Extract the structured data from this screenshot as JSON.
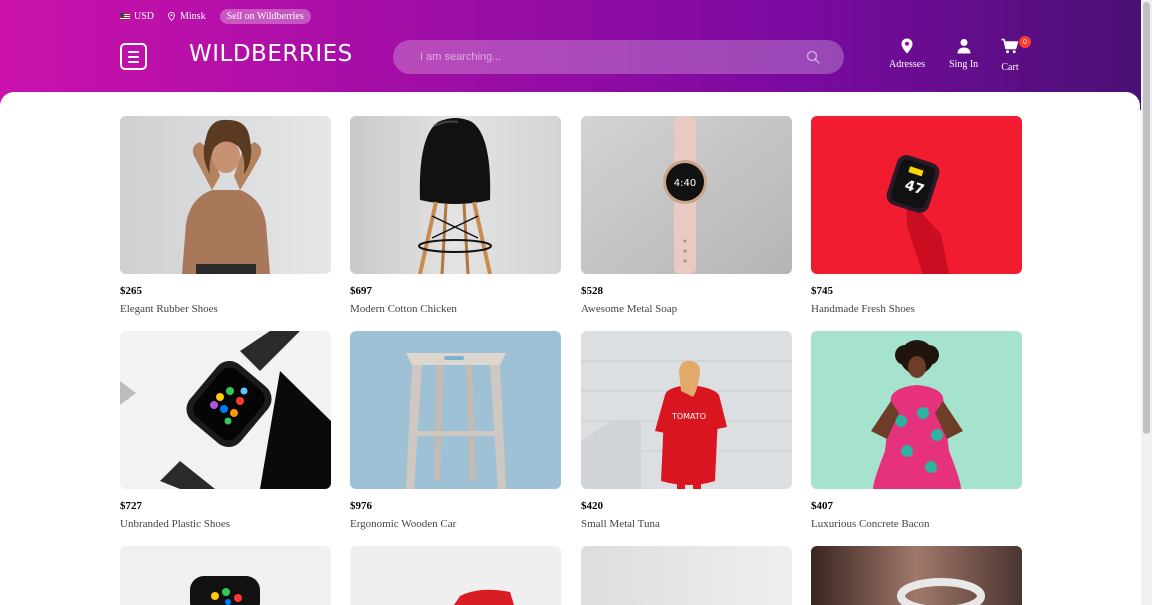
{
  "header": {
    "currency": "USD",
    "city": "Minsk",
    "sell_label": "Sell on Wildberries",
    "logo": "WILDBERRIES",
    "search_placeholder": "I am searching...",
    "addresses_label": "Adresses",
    "signin_label": "Sing In",
    "cart_label": "Cart",
    "cart_count": "0"
  },
  "products": [
    {
      "price": "$265",
      "name": "Elegant Rubber Shoes"
    },
    {
      "price": "$697",
      "name": "Modern Cotton Chicken"
    },
    {
      "price": "$528",
      "name": "Awesome Metal Soap"
    },
    {
      "price": "$745",
      "name": "Handmade Fresh Shoes"
    },
    {
      "price": "$727",
      "name": "Unbranded Plastic Shoes"
    },
    {
      "price": "$976",
      "name": "Ergonomic Wooden Car"
    },
    {
      "price": "$420",
      "name": "Small Metal Tuna"
    },
    {
      "price": "$407",
      "name": "Luxurious Concrete Bacon"
    }
  ],
  "colors": {
    "brand_gradient_start": "#cb11ab",
    "brand_gradient_end": "#481173",
    "badge": "#ff3b30"
  }
}
